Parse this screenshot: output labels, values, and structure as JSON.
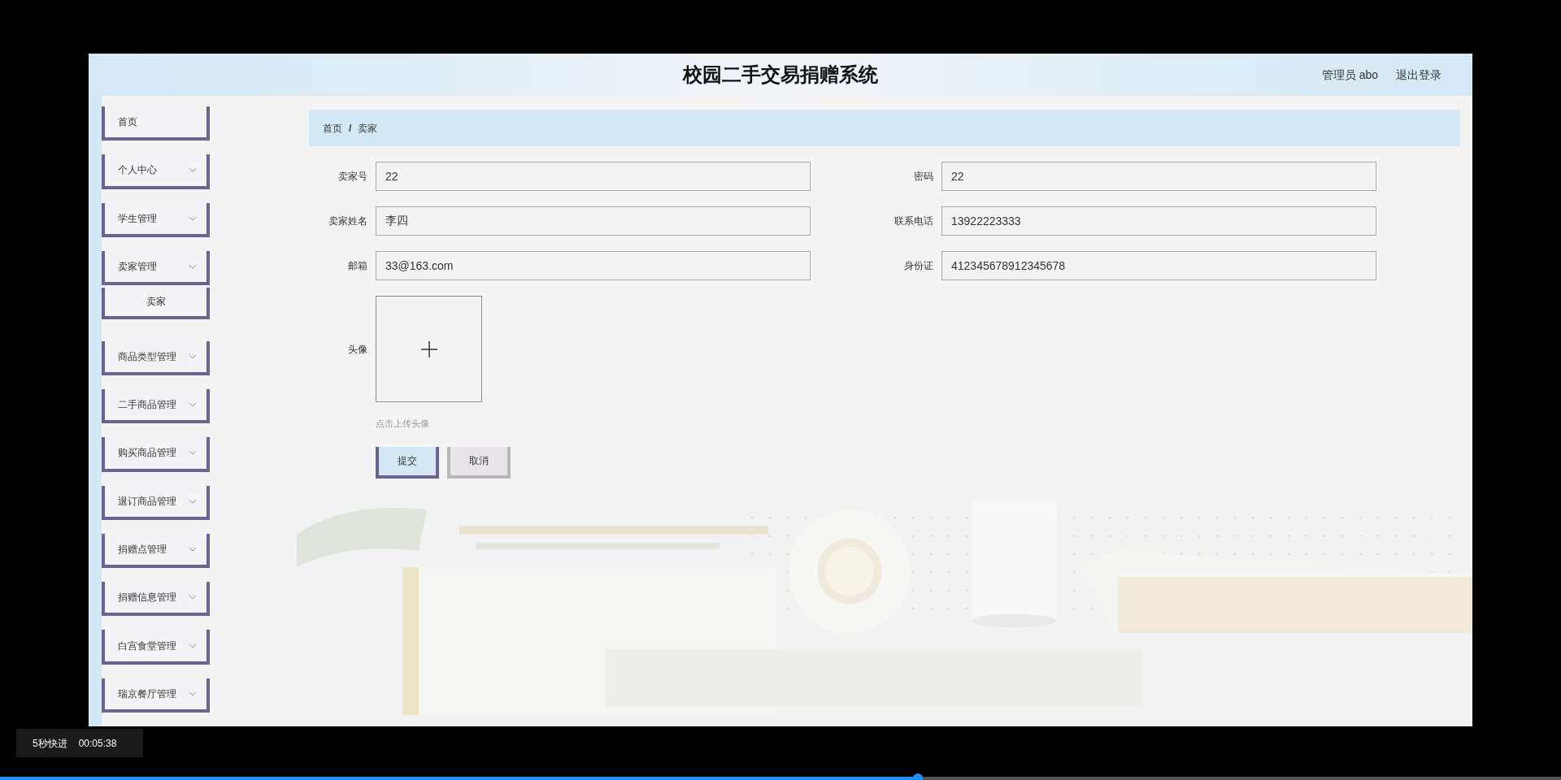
{
  "page": {
    "header": {
      "title": "校园二手交易捐赠系统",
      "user": "管理员 abo",
      "logout": "退出登录"
    },
    "sidebar": {
      "items": [
        {
          "label": "首页",
          "kind": "link"
        },
        {
          "label": "个人中心",
          "kind": "group"
        },
        {
          "label": "学生管理",
          "kind": "group"
        },
        {
          "label": "卖家管理",
          "kind": "group",
          "children": [
            {
              "label": "卖家"
            }
          ]
        },
        {
          "label": "商品类型管理",
          "kind": "group"
        },
        {
          "label": "二手商品管理",
          "kind": "group"
        },
        {
          "label": "购买商品管理",
          "kind": "group"
        },
        {
          "label": "退订商品管理",
          "kind": "group"
        },
        {
          "label": "捐赠点管理",
          "kind": "group"
        },
        {
          "label": "捐赠信息管理",
          "kind": "group"
        },
        {
          "label": "白宫食堂管理",
          "kind": "group"
        },
        {
          "label": "瑞京餐厅管理",
          "kind": "group"
        }
      ]
    },
    "breadcrumb": [
      "首页",
      "卖家"
    ],
    "breadcrumb_separator": "/",
    "form": {
      "fields": [
        {
          "label": "卖家号",
          "value": "22"
        },
        {
          "label": "密码",
          "value": "22"
        },
        {
          "label": "卖家姓名",
          "value": "李四"
        },
        {
          "label": "联系电话",
          "value": "13922223333"
        },
        {
          "label": "邮箱",
          "value": "33@163.com"
        },
        {
          "label": "身份证",
          "value": "412345678912345678"
        }
      ],
      "avatar": {
        "label": "头像",
        "hint": "点击上传头像"
      },
      "buttons": [
        {
          "label": "提交",
          "kind": "primary"
        },
        {
          "label": "取消",
          "kind": "secondary"
        }
      ]
    }
  },
  "player": {
    "skip_button": "5秒快进",
    "time": "00:05:38",
    "progress": {
      "level": 0.588
    }
  }
}
